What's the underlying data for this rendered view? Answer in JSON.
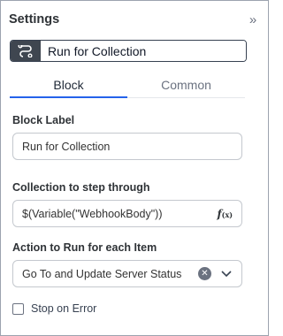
{
  "header": {
    "title": "Settings",
    "collapse_icon": "double-chevron-right-icon"
  },
  "block_name": {
    "value": "Run for Collection",
    "icon": "loop-icon"
  },
  "tabs": [
    {
      "label": "Block",
      "active": true
    },
    {
      "label": "Common",
      "active": false
    }
  ],
  "form": {
    "block_label": {
      "label": "Block Label",
      "value": "Run for Collection"
    },
    "collection": {
      "label": "Collection to step through",
      "value": "$(Variable(\"WebhookBody\"))",
      "fx_icon": "function-icon"
    },
    "action": {
      "label": "Action to Run for each Item",
      "value": "Go To and Update Server Status"
    },
    "stop_on_error": {
      "label": "Stop on Error",
      "checked": false
    }
  },
  "colors": {
    "accent": "#2563eb",
    "icon_bg": "#3f4650"
  }
}
